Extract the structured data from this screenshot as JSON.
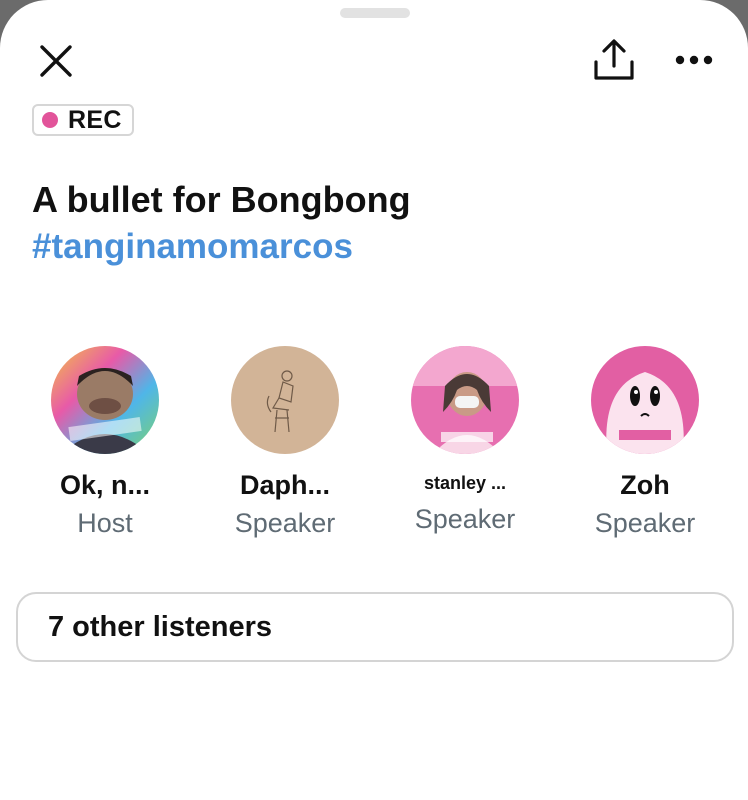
{
  "header": {
    "close_icon": "close-icon",
    "share_icon": "share-icon",
    "more_icon": "more-horizontal-icon"
  },
  "recording": {
    "label": "REC",
    "dot_color": "#e2549a"
  },
  "space": {
    "title": "A bullet for Bongbong",
    "hashtag": "#tanginamomarcos",
    "hashtag_color": "#4a90d9"
  },
  "participants": [
    {
      "name": "Ok, n...",
      "role": "Host"
    },
    {
      "name": "Daph...",
      "role": "Speaker"
    },
    {
      "name": "stanley ...",
      "role": "Speaker"
    },
    {
      "name": "Zoh",
      "role": "Speaker"
    }
  ],
  "listeners": {
    "label": "7 other listeners"
  }
}
